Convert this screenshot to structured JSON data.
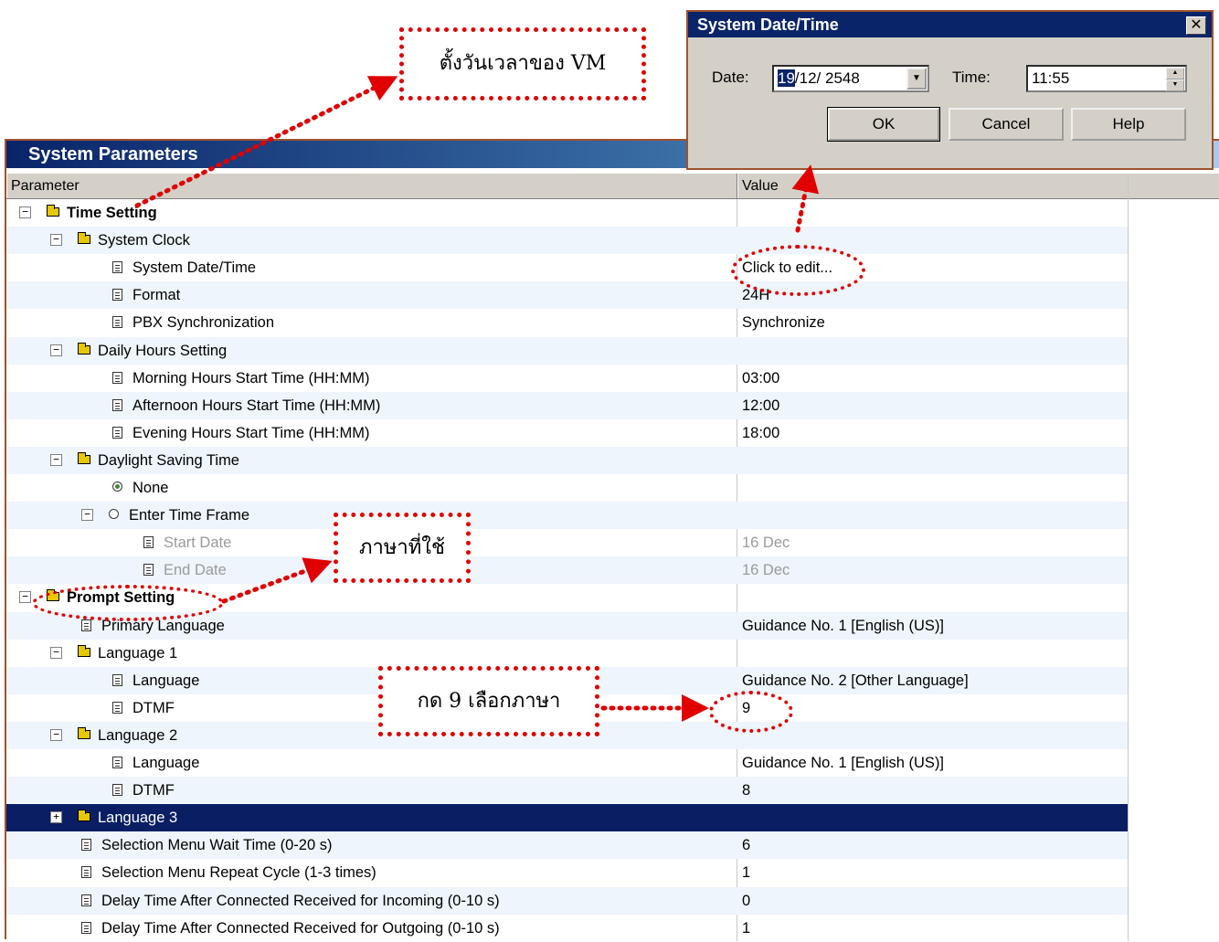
{
  "window": {
    "title": "System Parameters"
  },
  "grid": {
    "col_parameter": "Parameter",
    "col_value": "Value"
  },
  "rows": [
    {
      "label": "Time Setting",
      "value": "",
      "indent": 0,
      "toggle": "−",
      "icon": "folder",
      "bold": true
    },
    {
      "label": "System Clock",
      "value": "",
      "indent": 1,
      "toggle": "−",
      "icon": "folder"
    },
    {
      "label": "System Date/Time",
      "value": "Click to edit...",
      "indent": 2,
      "icon": "doc"
    },
    {
      "label": "Format",
      "value": "24H",
      "indent": 2,
      "icon": "doc"
    },
    {
      "label": "PBX Synchronization",
      "value": "Synchronize",
      "indent": 2,
      "icon": "doc"
    },
    {
      "label": "Daily Hours Setting",
      "value": "",
      "indent": 1,
      "toggle": "−",
      "icon": "folder"
    },
    {
      "label": "Morning Hours Start Time (HH:MM)",
      "value": "03:00",
      "indent": 2,
      "icon": "doc"
    },
    {
      "label": "Afternoon Hours Start Time (HH:MM)",
      "value": "12:00",
      "indent": 2,
      "icon": "doc"
    },
    {
      "label": "Evening Hours Start Time (HH:MM)",
      "value": "18:00",
      "indent": 2,
      "icon": "doc"
    },
    {
      "label": "Daylight Saving Time",
      "value": "",
      "indent": 1,
      "toggle": "−",
      "icon": "folder"
    },
    {
      "label": "None",
      "value": "",
      "indent": 2,
      "icon": "radio-on"
    },
    {
      "label": "Enter Time Frame",
      "value": "",
      "indent": 2,
      "toggle": "−",
      "icon": "radio"
    },
    {
      "label": "Start Date",
      "value": "16 Dec",
      "indent": 3,
      "icon": "doc",
      "dim": true
    },
    {
      "label": "End Date",
      "value": "16 Dec",
      "indent": 3,
      "icon": "doc",
      "dim": true
    },
    {
      "label": "Prompt Setting",
      "value": "",
      "indent": 0,
      "toggle": "−",
      "icon": "folder",
      "bold": true
    },
    {
      "label": "Primary Language",
      "value": "Guidance No. 1 [English (US)]",
      "indent": 1,
      "icon": "doc"
    },
    {
      "label": "Language 1",
      "value": "",
      "indent": 1,
      "toggle": "−",
      "icon": "folder"
    },
    {
      "label": "Language",
      "value": "Guidance No. 2 [Other Language]",
      "indent": 2,
      "icon": "doc"
    },
    {
      "label": "DTMF",
      "value": "9",
      "indent": 2,
      "icon": "doc"
    },
    {
      "label": "Language 2",
      "value": "",
      "indent": 1,
      "toggle": "−",
      "icon": "folder"
    },
    {
      "label": "Language",
      "value": "Guidance No. 1 [English (US)]",
      "indent": 2,
      "icon": "doc"
    },
    {
      "label": "DTMF",
      "value": "8",
      "indent": 2,
      "icon": "doc"
    },
    {
      "label": "Language 3",
      "value": "",
      "indent": 1,
      "toggle": "+",
      "icon": "folder",
      "selected": true
    },
    {
      "label": "Selection Menu Wait Time (0-20 s)",
      "value": "6",
      "indent": 1,
      "icon": "doc"
    },
    {
      "label": "Selection Menu Repeat Cycle (1-3 times)",
      "value": "1",
      "indent": 1,
      "icon": "doc"
    },
    {
      "label": "Delay Time After Connected Received for Incoming (0-10 s)",
      "value": "0",
      "indent": 1,
      "icon": "doc"
    },
    {
      "label": "Delay Time After Connected Received for Outgoing (0-10 s)",
      "value": "1",
      "indent": 1,
      "icon": "doc"
    }
  ],
  "dialog": {
    "title": "System Date/Time",
    "close": "✕",
    "date_label": "Date:",
    "date_value_day": "19",
    "date_value_rest": "/12/ 2548",
    "time_label": "Time:",
    "time_value": "11:55",
    "ok": "OK",
    "cancel": "Cancel",
    "help": "Help"
  },
  "annotations": {
    "set_vm_time": "ตั้งวันเวลาของ VM",
    "language_used": "ภาษาที่ใช้",
    "press_9": "กด 9 เลือกภาษา"
  },
  "colors": {
    "annotation": "#e00000",
    "selection": "#0a1f63",
    "title_bar": "#0a246a"
  }
}
